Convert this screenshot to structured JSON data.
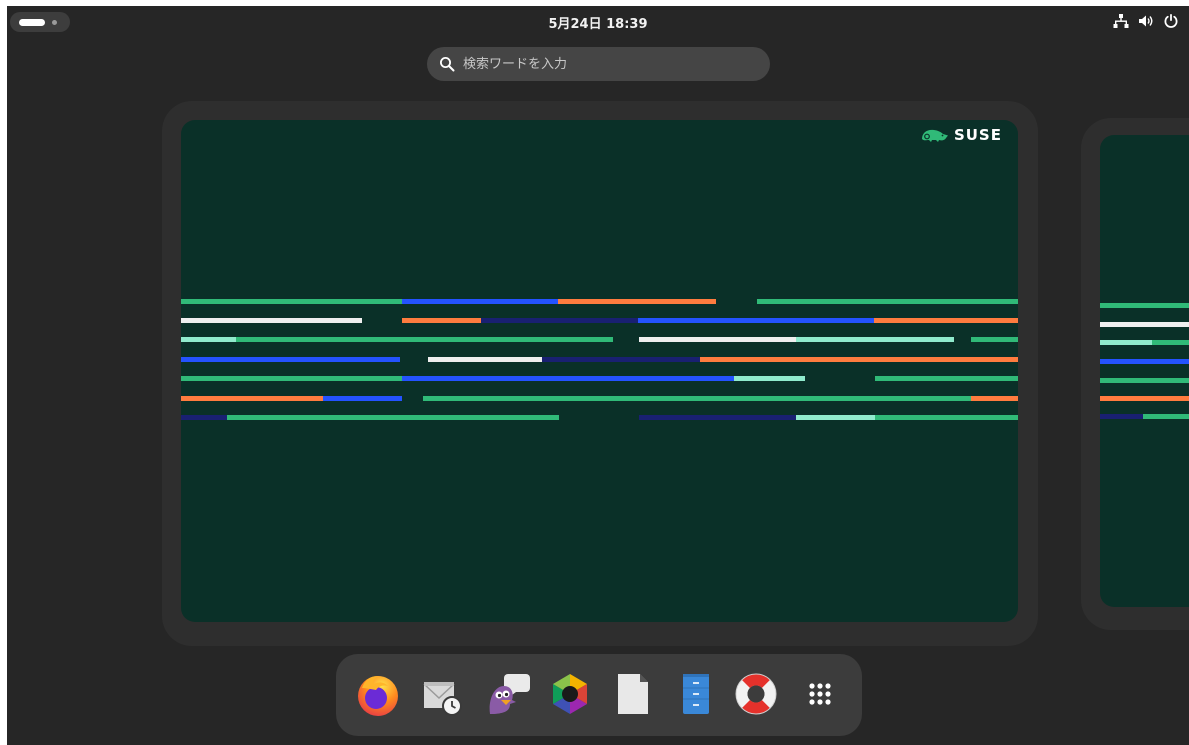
{
  "topbar": {
    "clock": "5月24日 18:39",
    "status_icons": [
      "network-wired-icon",
      "volume-icon",
      "power-icon"
    ]
  },
  "search": {
    "placeholder": "検索ワードを入力",
    "value": ""
  },
  "workspaces": [
    {
      "name": "workspace-1",
      "wallpaper_logo": "SUSE",
      "active": true
    },
    {
      "name": "workspace-2",
      "active": false
    }
  ],
  "dock": {
    "apps": [
      {
        "id": "firefox",
        "icon": "firefox-icon"
      },
      {
        "id": "evolution",
        "icon": "evolution-mail-calendar-icon"
      },
      {
        "id": "pidgin",
        "icon": "pidgin-chat-icon"
      },
      {
        "id": "polari",
        "icon": "hexagon-app-icon"
      },
      {
        "id": "libreoffice",
        "icon": "document-icon"
      },
      {
        "id": "file-roller",
        "icon": "archive-cabinet-icon"
      },
      {
        "id": "help",
        "icon": "lifebuoy-help-icon"
      },
      {
        "id": "show-apps",
        "icon": "app-grid-icon"
      }
    ]
  },
  "colors": {
    "panel_bg": "#262626",
    "wallpaper_bg": "#0a3028",
    "suse_green": "#30ba78",
    "stripe_blue": "#2453ff",
    "stripe_orange": "#fe7c3f",
    "stripe_navy": "#192072",
    "stripe_mint": "#90ebcd",
    "stripe_white": "#efefef"
  }
}
